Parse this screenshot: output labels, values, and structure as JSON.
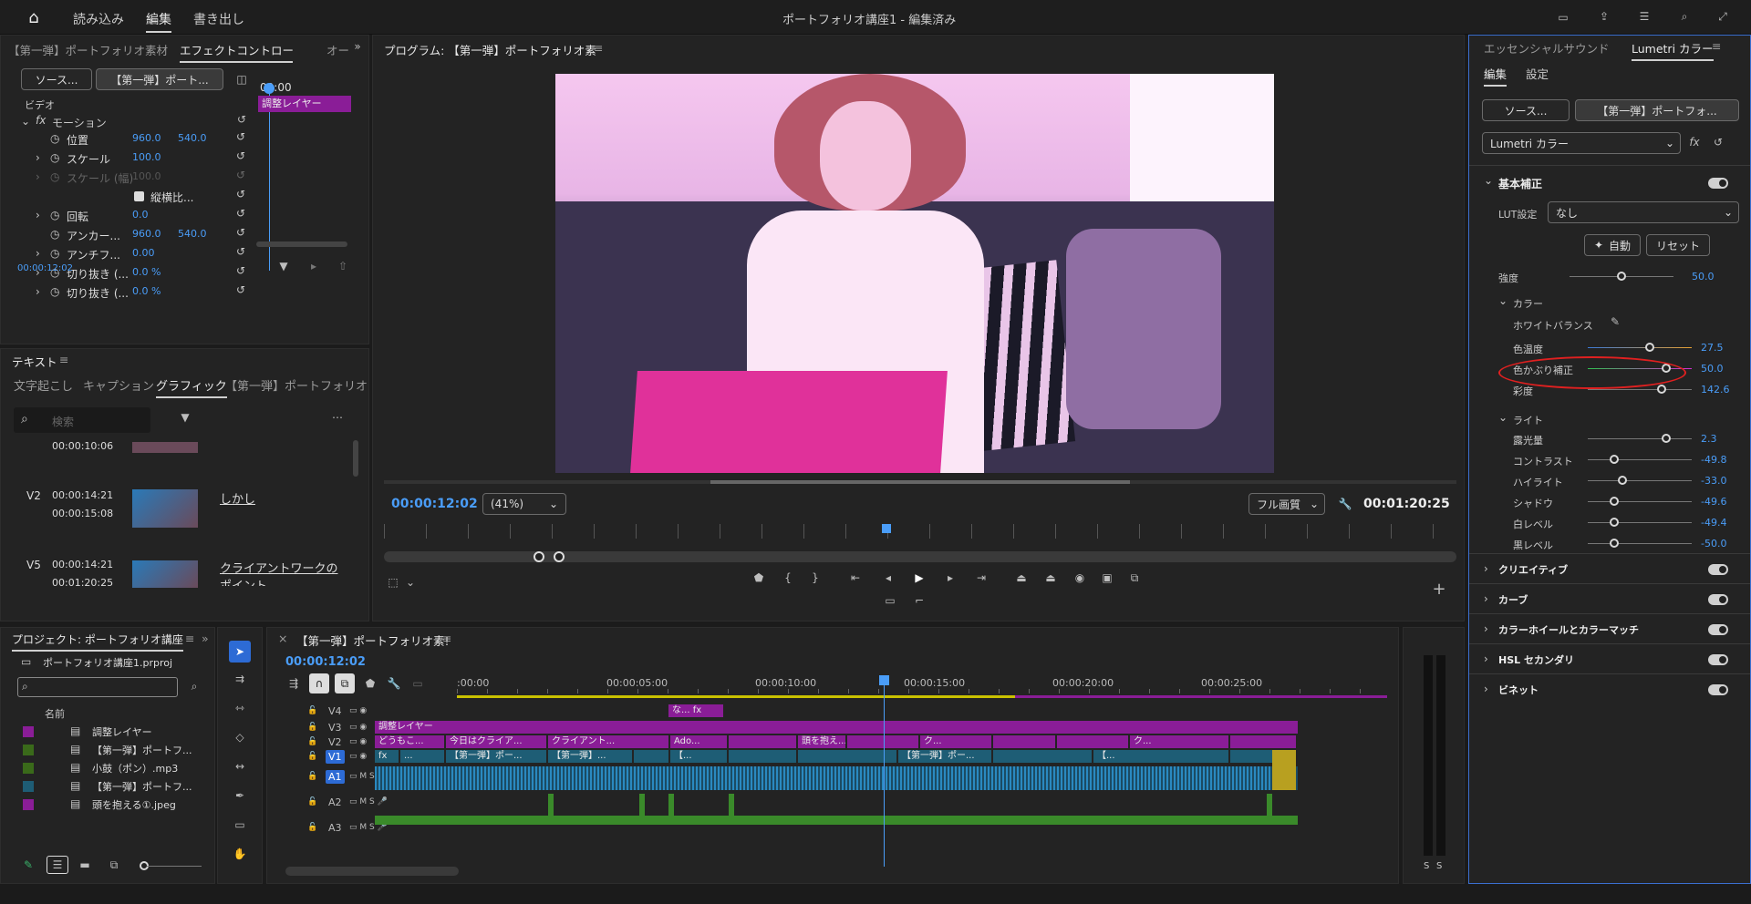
{
  "topbar": {
    "menu": [
      "読み込み",
      "編集",
      "書き出し"
    ],
    "active": "編集",
    "title": "ポートフォリオ講座1 - 編集済み"
  },
  "effects_panel": {
    "tabs": [
      "【第一弾】ポートフォリオ素材",
      "エフェクトコントロール",
      "オー"
    ],
    "source_btn": "ソース...",
    "seq_btn": "【第一弾】ポート...",
    "timecode_small": "00:00",
    "video_label": "ビデオ",
    "motion_label": "モーション",
    "adjust_clip": "調整レイヤー",
    "rows": [
      {
        "label": "位置",
        "v1": "960.0",
        "v2": "540.0"
      },
      {
        "label": "スケール",
        "v1": "100.0",
        "v2": ""
      },
      {
        "label": "スケール (幅)",
        "v1": "100.0",
        "v2": ""
      },
      {
        "label": "縦横比...",
        "v1": "",
        "v2": ""
      },
      {
        "label": "回転",
        "v1": "0.0",
        "v2": ""
      },
      {
        "label": "アンカー...",
        "v1": "960.0",
        "v2": "540.0"
      },
      {
        "label": "アンチフ...",
        "v1": "0.00",
        "v2": ""
      },
      {
        "label": "切り抜き (...",
        "v1": "0.0 %",
        "v2": ""
      },
      {
        "label": "切り抜き (...",
        "v1": "0.0 %",
        "v2": ""
      }
    ],
    "timecode": "00:00:12:02"
  },
  "text_panel": {
    "title": "テキスト",
    "tabs": [
      "文字起こし",
      "キャプション",
      "グラフィック",
      "【第一弾】ポートフォリオ..."
    ],
    "active": "グラフィック",
    "search_placeholder": "検索",
    "items": [
      {
        "track": "",
        "in": "00:00:10:06",
        "out": "",
        "label": ""
      },
      {
        "track": "V2",
        "in": "00:00:14:21",
        "out": "00:00:15:08",
        "label": "しかし"
      },
      {
        "track": "V5",
        "in": "00:00:14:21",
        "out": "00:01:20:25",
        "label": "クライアントワークのポイント"
      }
    ]
  },
  "program": {
    "title": "プログラム: 【第一弾】ポートフォリオ素",
    "timecode": "00:00:12:02",
    "zoom": "(41%)",
    "quality": "フル画質",
    "duration": "00:01:20:25"
  },
  "project": {
    "title": "プロジェクト: ポートフォリオ講座",
    "file": "ポートフォリオ講座1.prproj",
    "name_col": "名前",
    "items": [
      {
        "label": "調整レイヤー",
        "color": "#8a1d97"
      },
      {
        "label": "【第一弾】ポートフ...",
        "color": "#3a6a1a"
      },
      {
        "label": "小鼓（ポン）.mp3",
        "color": "#3a6a1a"
      },
      {
        "label": "【第一弾】ポートフ...",
        "color": "#1e5d75"
      },
      {
        "label": "頭を抱える①.jpeg",
        "color": "#8a1d97"
      }
    ]
  },
  "timeline": {
    "title": "【第一弾】ポートフォリオ素!",
    "timecode": "00:00:12:02",
    "ruler": [
      ":00:00",
      "00:00:05:00",
      "00:00:10:00",
      "00:00:15:00",
      "00:00:20:00",
      "00:00:25:00"
    ],
    "tracks": [
      "V4",
      "V3",
      "V2",
      "V1",
      "A1",
      "A2",
      "A3"
    ],
    "v4_clips": [
      "な...",
      "fx"
    ],
    "v3_clip": "調整レイヤー",
    "v2_clips": [
      "どうもこ...",
      "今日はクライア...",
      "クライアント...",
      "Ado...",
      "頭を抱え...",
      "ク...",
      "ク..."
    ],
    "v1_clips": [
      "fx",
      "...",
      "【第一弾】ポー...",
      "【第一弾】...",
      "【...",
      "【第一弾】ポー...",
      "【..."
    ]
  },
  "lumetri": {
    "tabs": [
      "エッセンシャルサウンド",
      "Lumetri カラー"
    ],
    "subtabs": [
      "編集",
      "設定"
    ],
    "source_btn": "ソース...",
    "seq_btn": "【第一弾】ポートフォ...",
    "effect_select": "Lumetri カラー",
    "basic": "基本補正",
    "lut_label": "LUT設定",
    "lut_value": "なし",
    "auto": "自動",
    "reset": "リセット",
    "intensity": {
      "label": "強度",
      "value": "50.0",
      "pos": 0.5
    },
    "color_section": "カラー",
    "wb": "ホワイトバランス",
    "color_sliders": [
      {
        "label": "色温度",
        "value": "27.5",
        "pos": 0.6
      },
      {
        "label": "色かぶり補正",
        "value": "50.0",
        "pos": 0.75
      },
      {
        "label": "彩度",
        "value": "142.6",
        "pos": 0.71
      }
    ],
    "light_section": "ライト",
    "light_sliders": [
      {
        "label": "露光量",
        "value": "2.3",
        "pos": 0.75
      },
      {
        "label": "コントラスト",
        "value": "-49.8",
        "pos": 0.25
      },
      {
        "label": "ハイライト",
        "value": "-33.0",
        "pos": 0.33
      },
      {
        "label": "シャドウ",
        "value": "-49.6",
        "pos": 0.25
      },
      {
        "label": "白レベル",
        "value": "-49.4",
        "pos": 0.25
      },
      {
        "label": "黒レベル",
        "value": "-50.0",
        "pos": 0.25
      }
    ],
    "sections": [
      "クリエイティブ",
      "カーブ",
      "カラーホイールとカラーマッチ",
      "HSL セカンダリ",
      "ビネット"
    ]
  },
  "colors": {
    "accent": "#4a9df8",
    "clip_purple": "#8a1d97",
    "clip_teal": "#1e5d75",
    "highlight": "#e02020"
  }
}
